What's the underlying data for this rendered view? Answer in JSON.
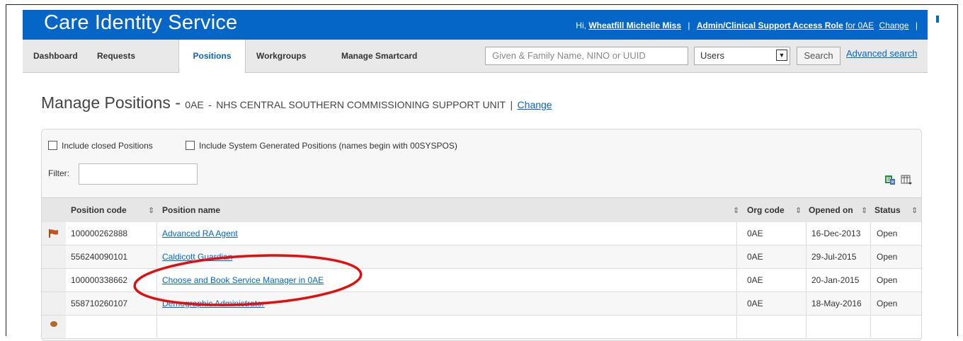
{
  "header": {
    "app_title": "Care Identity Service",
    "greeting": "Hi,",
    "user_name": "Wheatfill Michelle Miss",
    "role": "Admin/Clinical Support Access Role",
    "role_org": "for 0AE",
    "change": "Change",
    "sep": "|",
    "brand_color": "#0566c7"
  },
  "nav": {
    "tabs": [
      {
        "label": "Dashboard"
      },
      {
        "label": "Requests"
      },
      {
        "label": "Positions",
        "active": true
      },
      {
        "label": "Workgroups"
      },
      {
        "label": "Manage Smartcard"
      }
    ],
    "search_placeholder": "Given & Family Name, NINO or UUID",
    "search_scope": "Users",
    "search_button": "Search",
    "advanced_search": "Advanced search"
  },
  "page": {
    "title": "Manage Positions",
    "dash": "-",
    "org_code": "0AE",
    "org_name": "NHS CENTRAL SOUTHERN COMMISSIONING SUPPORT UNIT",
    "sep": "|",
    "change": "Change"
  },
  "filters": {
    "include_closed": "Include closed Positions",
    "include_system": "Include System Generated Positions (names begin with 00SYSPOS)",
    "filter_label": "Filter:"
  },
  "table": {
    "columns": [
      "Position code",
      "Position name",
      "Org code",
      "Opened on",
      "Status"
    ],
    "rows": [
      {
        "code": "100000262888",
        "name": "Advanced RA Agent",
        "org": "0AE",
        "opened": "16-Dec-2013",
        "status": "Open",
        "flag": true
      },
      {
        "code": "556240090101",
        "name": "Caldicott Guardian",
        "org": "0AE",
        "opened": "29-Jul-2015",
        "status": "Open"
      },
      {
        "code": "100000338662",
        "name": "Choose and Book Service Manager in 0AE",
        "org": "0AE",
        "opened": "20-Jan-2015",
        "status": "Open"
      },
      {
        "code": "558710260107",
        "name": "Demographic Administrator",
        "org": "0AE",
        "opened": "18-May-2016",
        "status": "Open"
      }
    ]
  },
  "annotation_color": "#e01010",
  "icons": {
    "export": "export-icon",
    "columns": "columns-icon",
    "flag": "flag-icon",
    "dropdown": "chevron-down-icon"
  }
}
